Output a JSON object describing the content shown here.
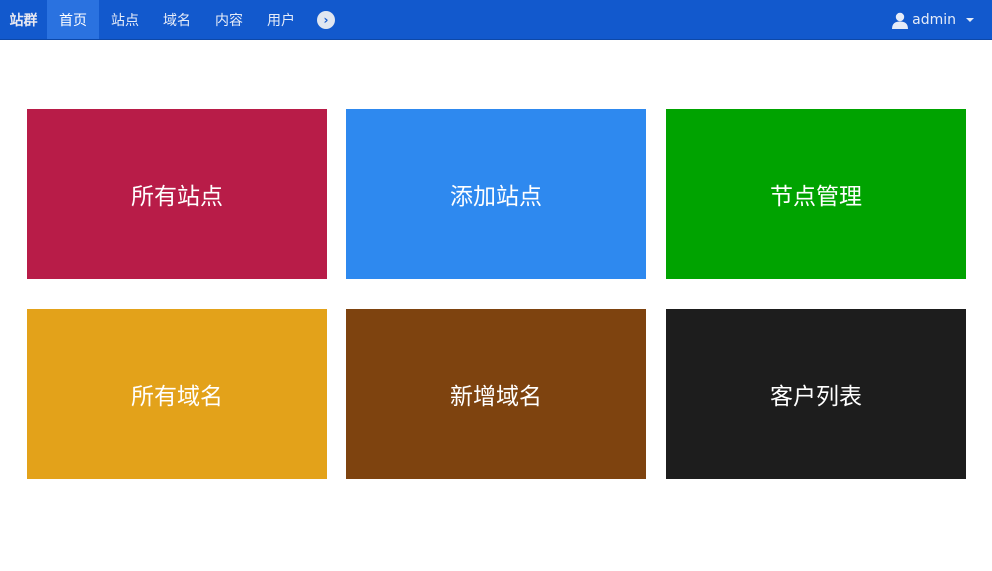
{
  "nav": {
    "brand": "站群",
    "items": [
      "首页",
      "站点",
      "域名",
      "内容",
      "用户"
    ],
    "active": 0,
    "user": "admin"
  },
  "tiles": [
    {
      "label": "所有站点",
      "color": "#b81c48"
    },
    {
      "label": "添加站点",
      "color": "#2e89ef"
    },
    {
      "label": "节点管理",
      "color": "#00a300"
    },
    {
      "label": "所有域名",
      "color": "#e3a21a"
    },
    {
      "label": "新增域名",
      "color": "#7e430f"
    },
    {
      "label": "客户列表",
      "color": "#1d1d1d"
    }
  ]
}
